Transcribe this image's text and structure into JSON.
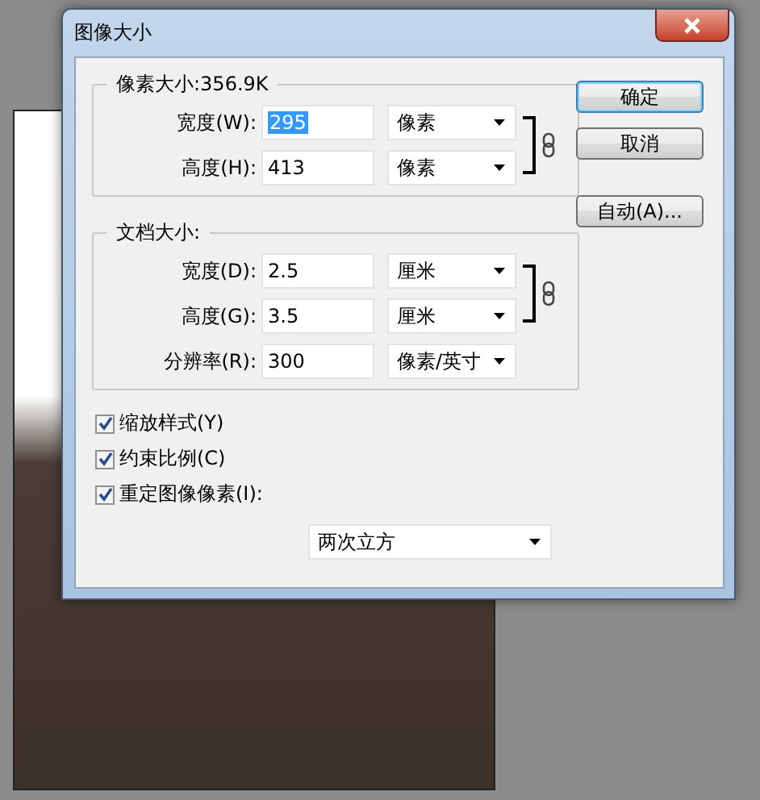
{
  "window": {
    "title": "图像大小"
  },
  "groups": [
    {
      "title": "像素大小:356.9K",
      "constrained": true,
      "rows": [
        {
          "label": "宽度(W):",
          "value": "295",
          "value_selected": true,
          "unit": "像素"
        },
        {
          "label": "高度(H):",
          "value": "413",
          "value_selected": false,
          "unit": "像素"
        }
      ]
    },
    {
      "title": "文档大小:",
      "constrained": true,
      "rows": [
        {
          "label": "宽度(D):",
          "value": "2.5",
          "value_selected": false,
          "unit": "厘米"
        },
        {
          "label": "高度(G):",
          "value": "3.5",
          "value_selected": false,
          "unit": "厘米"
        },
        {
          "label": "分辨率(R):",
          "value": "300",
          "value_selected": false,
          "unit": "像素/英寸"
        }
      ]
    }
  ],
  "options": [
    {
      "label": "缩放样式(Y)",
      "checked": true
    },
    {
      "label": "约束比例(C)",
      "checked": true
    },
    {
      "label": "重定图像像素(I):",
      "checked": true
    }
  ],
  "resample": {
    "value": "两次立方"
  },
  "buttons": [
    {
      "label": "确定",
      "default": true
    },
    {
      "label": "取消",
      "default": false
    },
    {
      "label": "自动(A)...",
      "default": false
    }
  ]
}
